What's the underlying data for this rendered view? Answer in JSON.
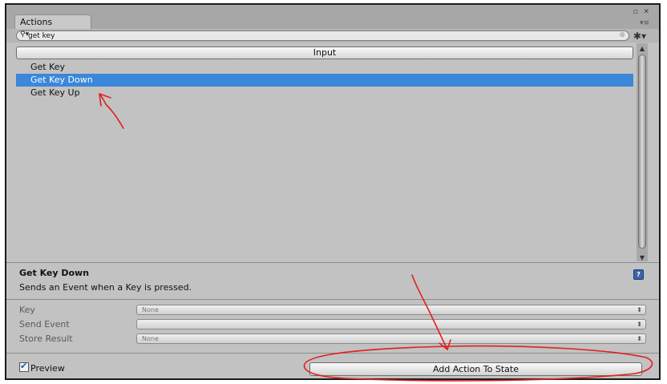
{
  "panel": {
    "tab_title": "Actions",
    "win_buttons": "▫ ✕",
    "menu_icon": "▾≡"
  },
  "search": {
    "value": "get key",
    "icon": "search-icon",
    "clear_icon": "clear-icon"
  },
  "settings_icon": "gear-icon",
  "category_header": "Input",
  "actions": [
    {
      "label": "Get Key",
      "selected": false
    },
    {
      "label": "Get Key Down",
      "selected": true
    },
    {
      "label": "Get Key Up",
      "selected": false
    }
  ],
  "description": {
    "title": "Get Key Down",
    "text": "Sends an Event when a Key is pressed.",
    "help_icon": "?"
  },
  "params": [
    {
      "label": "Key",
      "value": "None"
    },
    {
      "label": "Send Event",
      "value": ""
    },
    {
      "label": "Store Result",
      "value": "None"
    }
  ],
  "footer": {
    "preview_label": "Preview",
    "preview_checked": true,
    "add_button_label": "Add Action To State"
  },
  "annotation_color": "#e02020",
  "colors": {
    "selection": "#3b87d9",
    "panel_bg": "#c2c2c2"
  }
}
